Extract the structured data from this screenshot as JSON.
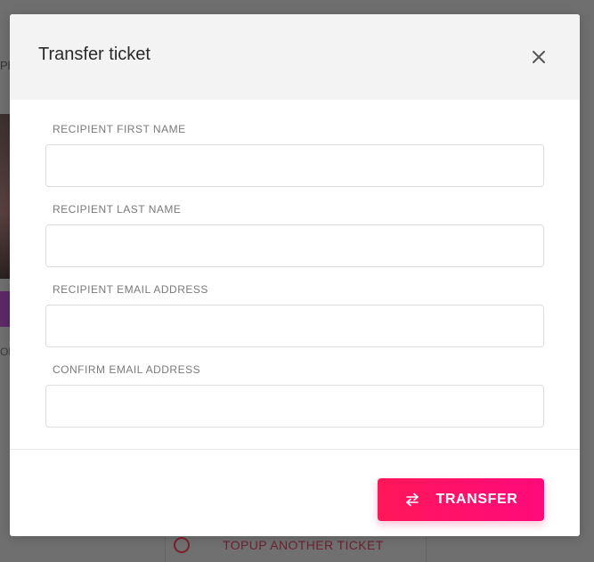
{
  "modal": {
    "title": "Transfer ticket",
    "close_icon": "close-icon",
    "fields": [
      {
        "label": "RECIPIENT FIRST NAME",
        "value": "",
        "placeholder": ""
      },
      {
        "label": "RECIPIENT LAST NAME",
        "value": "",
        "placeholder": ""
      },
      {
        "label": "RECIPIENT EMAIL ADDRESS",
        "value": "",
        "placeholder": ""
      },
      {
        "label": "CONFIRM EMAIL ADDRESS",
        "value": "",
        "placeholder": ""
      }
    ],
    "submit": {
      "label": "TRANSFER",
      "icon": "transfer-arrows-icon",
      "color_start": "#ff1759",
      "color_end": "#ff0a7c"
    }
  },
  "background": {
    "fragment_top": "Ph",
    "fragment_mid": "Ol",
    "topup_label": "TOPUP ANOTHER TICKET",
    "topup_icon": "fingerprint-icon",
    "overlay_color": "#6f6f70"
  }
}
